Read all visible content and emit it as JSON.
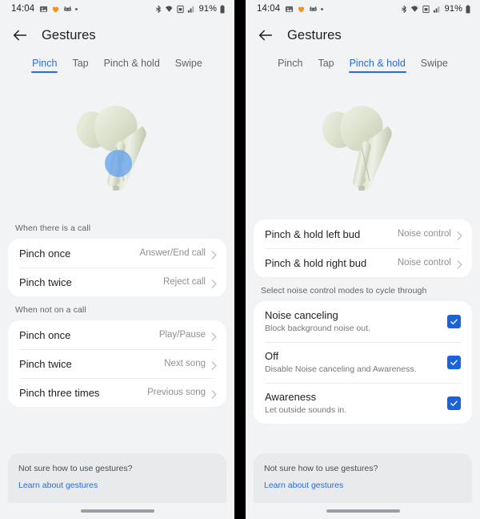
{
  "status_bar": {
    "time": "14:04",
    "left_icons": [
      "gallery-icon",
      "heart-icon",
      "game-controller-icon",
      "more-dot-icon"
    ],
    "right_icons": [
      "bluetooth-icon",
      "wifi-icon",
      "sim-icon",
      "signal-icon"
    ],
    "battery": "91%",
    "battery_icon": "battery-icon"
  },
  "app_bar": {
    "back_icon": "back-arrow-icon",
    "title": "Gestures"
  },
  "tabs": [
    {
      "label": "Pinch"
    },
    {
      "label": "Tap"
    },
    {
      "label": "Pinch & hold"
    },
    {
      "label": "Swipe"
    }
  ],
  "colors": {
    "accent": "#2c6bd8",
    "checkbox": "#1a62e0",
    "page_bg": "#f2f3f5",
    "card_bg": "#ffffff",
    "footer_bg": "#e9eaec",
    "earbud": "#d7dfca",
    "highlight": "#5b9bf0"
  },
  "left_panel": {
    "active_tab": "Pinch",
    "hero": {
      "name": "earbud-illustration",
      "highlight": true
    },
    "groups": [
      {
        "label": "When there is a call",
        "rows": [
          {
            "title": "Pinch once",
            "value": "Answer/End call"
          },
          {
            "title": "Pinch twice",
            "value": "Reject call"
          }
        ]
      },
      {
        "label": "When not on a call",
        "rows": [
          {
            "title": "Pinch once",
            "value": "Play/Pause"
          },
          {
            "title": "Pinch twice",
            "value": "Next song"
          },
          {
            "title": "Pinch three times",
            "value": "Previous song"
          }
        ]
      }
    ],
    "footer": {
      "question": "Not sure how to use gestures?",
      "link": "Learn about gestures"
    }
  },
  "right_panel": {
    "active_tab": "Pinch & hold",
    "hero": {
      "name": "earbud-illustration",
      "highlight": false
    },
    "bud_rows": [
      {
        "title": "Pinch & hold left bud",
        "value": "Noise control"
      },
      {
        "title": "Pinch & hold right bud",
        "value": "Noise control"
      }
    ],
    "modes_label": "Select noise control modes to cycle through",
    "modes": [
      {
        "title": "Noise canceling",
        "subtitle": "Block background noise out.",
        "checked": true
      },
      {
        "title": "Off",
        "subtitle": "Disable Noise canceling and Awareness.",
        "checked": true
      },
      {
        "title": "Awareness",
        "subtitle": "Let outside sounds in.",
        "checked": true
      }
    ],
    "footer": {
      "question": "Not sure how to use gestures?",
      "link": "Learn about gestures"
    }
  }
}
